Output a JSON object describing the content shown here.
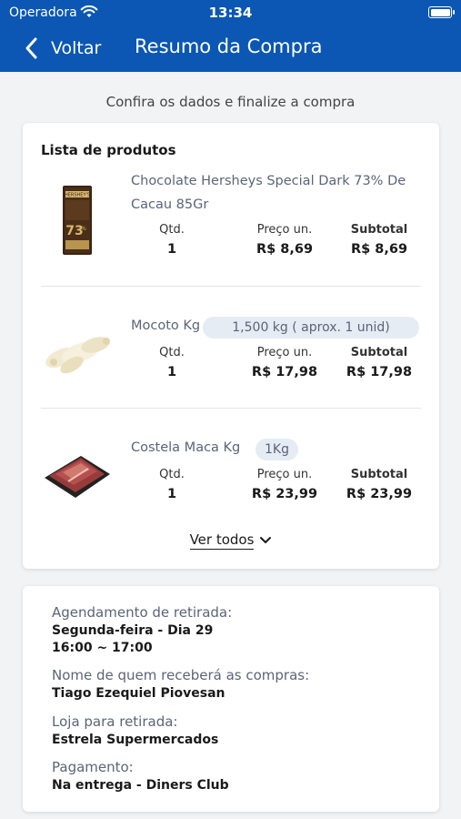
{
  "status_bar": {
    "carrier": "Operadora",
    "time": "13:34"
  },
  "nav": {
    "back_label": "Voltar",
    "title": "Resumo da Compra"
  },
  "subtitle": "Confira os dados e finalize a compra",
  "products_card": {
    "title": "Lista de produtos",
    "column_labels": {
      "qty": "Qtd.",
      "unit_price": "Preço un.",
      "subtotal": "Subtotal"
    },
    "items": [
      {
        "name": "Chocolate Hersheys Special Dark 73% De Cacau 85Gr",
        "unit_info": "",
        "qty": "1",
        "unit_price": "R$ 8,69",
        "subtotal": "R$ 8,69",
        "icon": "chocolate-bar-icon"
      },
      {
        "name": "Mocoto Kg",
        "unit_info": "1,500 kg ( aprox. 1 unid)",
        "qty": "1",
        "unit_price": "R$ 17,98",
        "subtotal": "R$ 17,98",
        "icon": "mocoto-meat-icon"
      },
      {
        "name": "Costela Maca Kg",
        "unit_info": "1Kg",
        "qty": "1",
        "unit_price": "R$ 23,99",
        "subtotal": "R$ 23,99",
        "icon": "rib-meat-tray-icon"
      }
    ],
    "see_all": "Ver todos"
  },
  "info_card": {
    "pickup_label": "Agendamento de retirada:",
    "pickup_day": "Segunda-feira - Dia 29",
    "pickup_time": "16:00 ~ 17:00",
    "receiver_label": "Nome de quem receberá as compras:",
    "receiver_name": "Tiago Ezequiel Piovesan",
    "store_label": "Loja para retirada:",
    "store_name": "Estrela Supermercados",
    "payment_label": "Pagamento:",
    "payment_value": "Na entrega - Diners Club"
  },
  "colors": {
    "brand_blue": "#0b57b3",
    "background": "#f2f3f5",
    "muted_text": "#5b6478",
    "pill_bg": "#e6ecf4"
  }
}
